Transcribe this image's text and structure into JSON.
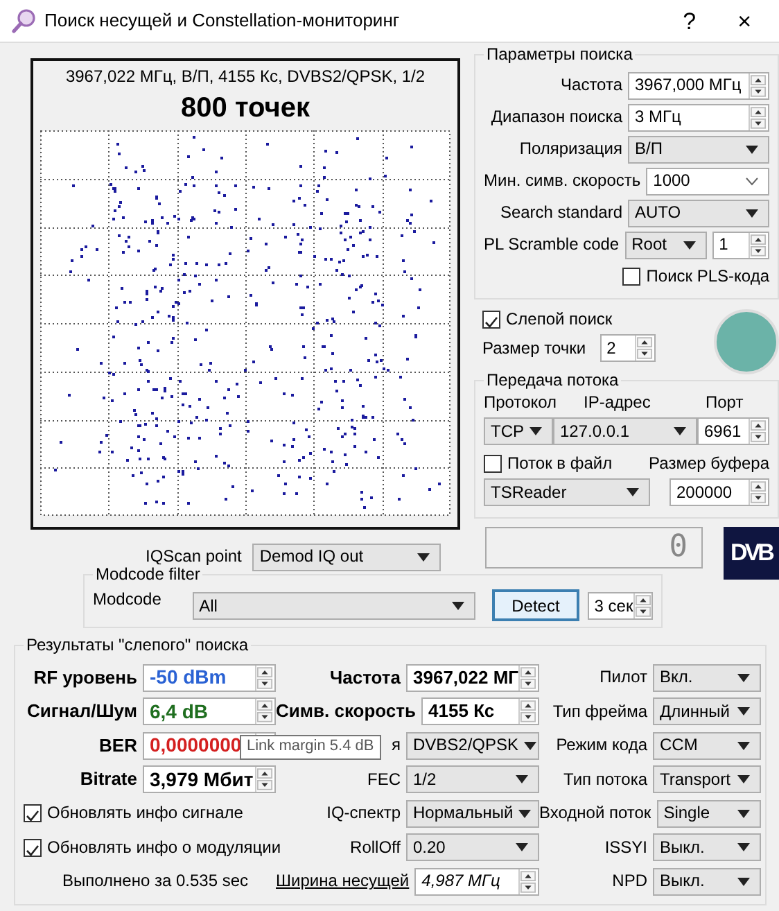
{
  "window": {
    "title": "Поиск несущей и Constellation-мониторинг",
    "help": "?",
    "close": "×"
  },
  "constellation": {
    "caption": "3967,022 МГц, В/П, 4155 Кс, DVBS2/QPSK, 1/2",
    "points": "800 точек"
  },
  "search_params": {
    "title": "Параметры поиска",
    "fields": [
      {
        "label": "Частота",
        "value": "3967,000 МГц",
        "kind": "spin"
      },
      {
        "label": "Диапазон поиска",
        "value": "3 МГц",
        "kind": "spin"
      },
      {
        "label": "Поляризация",
        "value": "В/П",
        "kind": "combo"
      },
      {
        "label": "Мин. симв. скорость",
        "value": "1000",
        "kind": "editcombo"
      },
      {
        "label": "Search standard",
        "value": "AUTO",
        "kind": "combo"
      },
      {
        "label": "PL Scramble code",
        "value": "Root",
        "value2": "1",
        "kind": "combospin"
      }
    ],
    "pls": {
      "label": "Поиск PLS-кода",
      "checked": false
    }
  },
  "blind": {
    "label": "Слепой поиск",
    "checked": true
  },
  "dot_size": {
    "label": "Размер точки",
    "value": "2"
  },
  "stream": {
    "title": "Передача потока",
    "protocol_label": "Протокол",
    "ip_label": "IP-адрес",
    "port_label": "Порт",
    "protocol": "TCP",
    "ip": "127.0.0.1",
    "port": "6961",
    "to_file": {
      "label": "Поток в файл",
      "checked": false
    },
    "buffer_label": "Размер буфера",
    "player": "TSReader",
    "buffer": "200000"
  },
  "display": {
    "value": "0"
  },
  "logo": {
    "text": "DVB"
  },
  "iqscan": {
    "label": "IQScan point",
    "value": "Demod IQ out"
  },
  "modcode": {
    "title": "Modcode filter",
    "label": "Modcode",
    "value": "All",
    "button": "Detect",
    "duration": "3 сек"
  },
  "results": {
    "title": "Результаты \"слепого\" поиска",
    "signal": [
      {
        "label": "RF уровень",
        "value": "-50 dBm",
        "color": "#2a62d4"
      },
      {
        "label": "Сигнал/Шум",
        "value": "6,4 dB",
        "color": "#1f6e1f"
      },
      {
        "label": "BER",
        "value": "0,0000000",
        "color": "#d42020"
      },
      {
        "label": "Bitrate",
        "value": "3,979 Мбит",
        "color": "#000000"
      }
    ],
    "options": [
      {
        "label": "Обновлять инфо сигнале",
        "checked": true
      },
      {
        "label": "Обновлять инфо о модуляции",
        "checked": true
      }
    ],
    "elapsed": "Выполнено за 0.535 sec",
    "modulation": [
      {
        "label": "Частота",
        "value": "3967,022 МГ",
        "kind": "spinbold"
      },
      {
        "label": "Симв. скорость",
        "value": "4155 Кс",
        "kind": "spinbold"
      },
      {
        "label": "я",
        "value": "DVBS2/QPSK",
        "kind": "combo"
      },
      {
        "label": "FEC",
        "value": "1/2",
        "kind": "combo"
      },
      {
        "label": "IQ-спектр",
        "value": "Нормальный",
        "kind": "combo"
      },
      {
        "label": "RollOff",
        "value": "0.20",
        "kind": "combo"
      },
      {
        "label": "Ширина несущей",
        "value": "4,987 МГц",
        "kind": "spinlink"
      }
    ],
    "stream_info": [
      {
        "label": "Пилот",
        "value": "Вкл."
      },
      {
        "label": "Тип фрейма",
        "value": "Длинный"
      },
      {
        "label": "Режим кода",
        "value": "CCM"
      },
      {
        "label": "Тип потока",
        "value": "Transport"
      },
      {
        "label": "Входной поток",
        "value": "Single"
      },
      {
        "label": "ISSYI",
        "value": "Выкл."
      },
      {
        "label": "NPD",
        "value": "Выкл."
      }
    ],
    "tooltip": "Link margin 5.4 dB"
  }
}
